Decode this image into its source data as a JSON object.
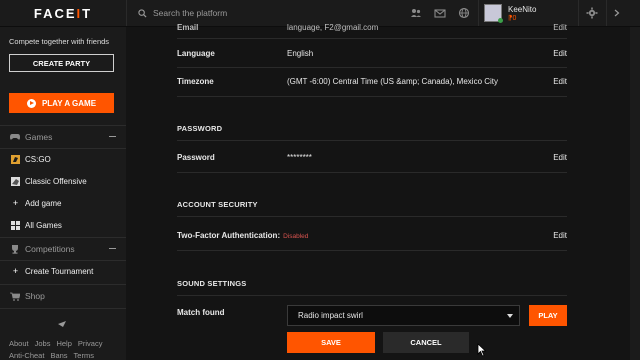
{
  "header": {
    "logo_left": "FACE",
    "logo_accent": "I",
    "logo_right": "T",
    "search_placeholder": "Search the platform",
    "username": "KeeNito",
    "user_level": "⁋0"
  },
  "sidebar": {
    "promo_text": "Compete together with friends",
    "create_party": "CREATE PARTY",
    "play_game": "PLAY A GAME",
    "games_label": "Games",
    "game_items": [
      "CS:GO",
      "Classic Offensive",
      "Add game",
      "All Games"
    ],
    "competitions_label": "Competitions",
    "create_tournament": "Create Tournament",
    "shop_label": "Shop",
    "footer_row1": [
      "About",
      "Jobs",
      "Help",
      "Privacy"
    ],
    "footer_row2": [
      "Anti-Cheat",
      "Bans",
      "Terms"
    ]
  },
  "settings": {
    "partial_row": {
      "label": "Email",
      "value": "language, F2@gmail.com",
      "edit": "Edit"
    },
    "language": {
      "label": "Language",
      "value": "English",
      "edit": "Edit"
    },
    "timezone": {
      "label": "Timezone",
      "value": "(GMT -6:00) Central Time (US &amp; Canada), Mexico City",
      "edit": "Edit"
    },
    "password_heading": "PASSWORD",
    "password": {
      "label": "Password",
      "value": "********",
      "edit": "Edit"
    },
    "security_heading": "ACCOUNT SECURITY",
    "two_factor": {
      "label": "Two-Factor Authentication:",
      "status": "Disabled",
      "edit": "Edit"
    },
    "sound_heading": "SOUND SETTINGS",
    "match_found": {
      "label": "Match found",
      "selected": "Radio impact swirl",
      "play": "PLAY"
    },
    "save": "SAVE",
    "cancel": "CANCEL"
  },
  "colors": {
    "accent": "#ff5500",
    "background": "#141414",
    "panel": "#1b1b1b",
    "danger": "#d9534f"
  }
}
